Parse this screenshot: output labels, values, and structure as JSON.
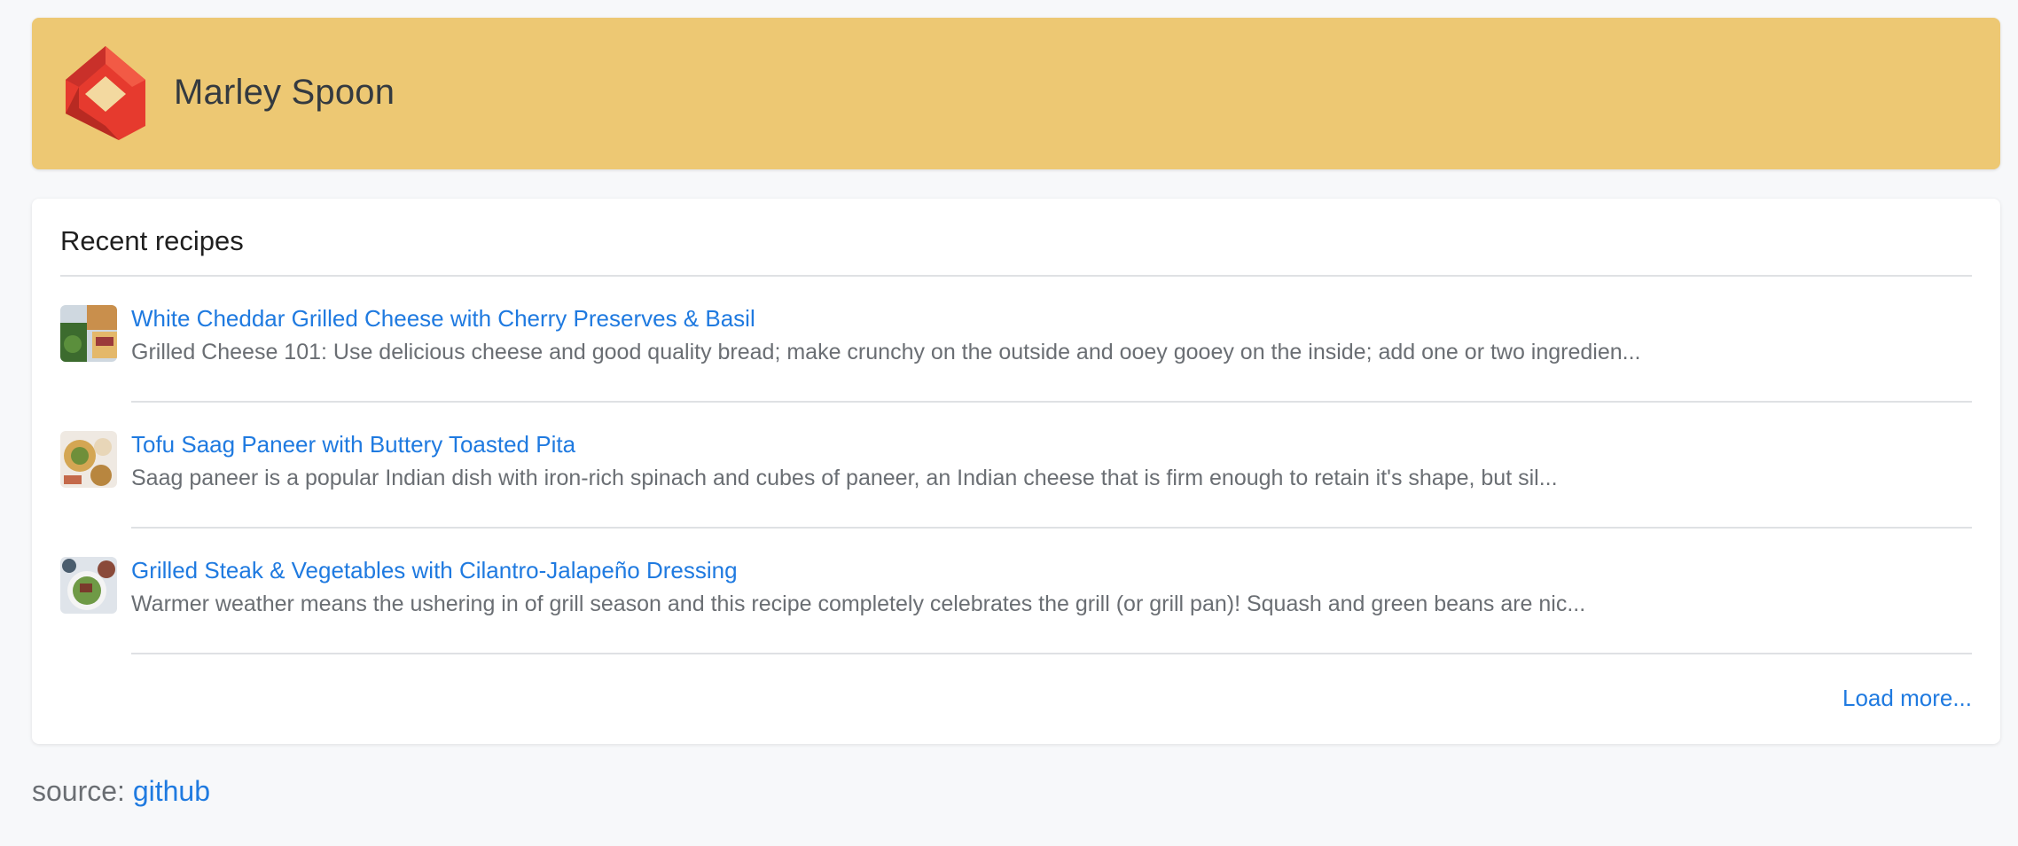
{
  "header": {
    "brand_name": "Marley Spoon",
    "logo_icon": "marley-spoon-logo",
    "colors": {
      "background": "#edc873",
      "logo_primary": "#e63a2e",
      "logo_dark": "#b82a22"
    }
  },
  "recipes_card": {
    "title": "Recent recipes",
    "items": [
      {
        "title": "White Cheddar Grilled Cheese with Cherry Preserves & Basil",
        "description": "Grilled Cheese 101: Use delicious cheese and good quality bread; make crunchy on the outside and ooey gooey on the inside; add one or two ingredien...",
        "thumbnail_icon": "recipe-thumbnail"
      },
      {
        "title": "Tofu Saag Paneer with Buttery Toasted Pita",
        "description": "Saag paneer is a popular Indian dish with iron-rich spinach and cubes of paneer, an Indian cheese that is firm enough to retain it's shape, but sil...",
        "thumbnail_icon": "recipe-thumbnail"
      },
      {
        "title": "Grilled Steak & Vegetables with Cilantro-Jalapeño Dressing",
        "description": "Warmer weather means the ushering in of grill season and this recipe completely celebrates the grill (or grill pan)! Squash and green beans are nic...",
        "thumbnail_icon": "recipe-thumbnail"
      }
    ],
    "load_more_label": "Load more..."
  },
  "footer": {
    "source_label": "source:",
    "source_link_label": "github"
  },
  "colors": {
    "link": "#1f7ae0",
    "muted_text": "#6a6e73",
    "page_background": "#f7f8fa"
  }
}
